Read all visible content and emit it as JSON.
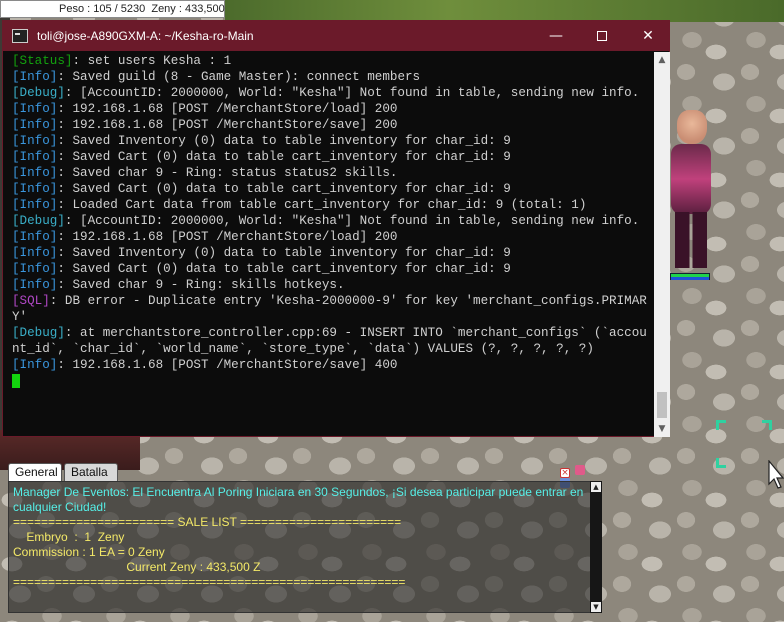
{
  "status_bar": {
    "text": "Peso : 105 / 5230  Zeny : 433,500"
  },
  "terminal": {
    "title": "toli@jose-A890GXM-A: ~/Kesha-ro-Main",
    "controls": {
      "minimize": "—",
      "close": "✕"
    },
    "lines": [
      {
        "tag": "[Status]",
        "tag_type": "status",
        "text": ": set users Kesha : 1"
      },
      {
        "tag": "[Info]",
        "tag_type": "info",
        "text": ": Saved guild (8 - Game Master): connect members"
      },
      {
        "tag": "[Debug]",
        "tag_type": "debug",
        "text": ": [AccountID: 2000000, World: \"Kesha\"] Not found in table, sending new info."
      },
      {
        "tag": "[Info]",
        "tag_type": "info",
        "text": ": 192.168.1.68 [POST /MerchantStore/load] 200"
      },
      {
        "tag": "[Info]",
        "tag_type": "info",
        "text": ": 192.168.1.68 [POST /MerchantStore/save] 200"
      },
      {
        "tag": "[Info]",
        "tag_type": "info",
        "text": ": Saved Inventory (0) data to table inventory for char_id: 9"
      },
      {
        "tag": "[Info]",
        "tag_type": "info",
        "text": ": Saved Cart (0) data to table cart_inventory for char_id: 9"
      },
      {
        "tag": "[Info]",
        "tag_type": "info",
        "text": ": Saved char 9 - Ring: status status2 skills."
      },
      {
        "tag": "[Info]",
        "tag_type": "info",
        "text": ": Saved Cart (0) data to table cart_inventory for char_id: 9"
      },
      {
        "tag": "[Info]",
        "tag_type": "info",
        "text": ": Loaded Cart data from table cart_inventory for char_id: 9 (total: 1)"
      },
      {
        "tag": "[Debug]",
        "tag_type": "debug",
        "text": ": [AccountID: 2000000, World: \"Kesha\"] Not found in table, sending new info."
      },
      {
        "tag": "[Info]",
        "tag_type": "info",
        "text": ": 192.168.1.68 [POST /MerchantStore/load] 200"
      },
      {
        "tag": "[Info]",
        "tag_type": "info",
        "text": ": Saved Inventory (0) data to table inventory for char_id: 9"
      },
      {
        "tag": "[Info]",
        "tag_type": "info",
        "text": ": Saved Cart (0) data to table cart_inventory for char_id: 9"
      },
      {
        "tag": "[Info]",
        "tag_type": "info",
        "text": ": Saved char 9 - Ring: skills hotkeys."
      },
      {
        "tag": "[SQL]",
        "tag_type": "sql",
        "text": ": DB error - Duplicate entry 'Kesha-2000000-9' for key 'merchant_configs.PRIMARY'"
      },
      {
        "tag": "[Debug]",
        "tag_type": "debug",
        "text": ": at merchantstore_controller.cpp:69 - INSERT INTO `merchant_configs` (`account_id`, `char_id`, `world_name`, `store_type`, `data`) VALUES (?, ?, ?, ?, ?)"
      },
      {
        "tag": "[Info]",
        "tag_type": "info",
        "text": ": 192.168.1.68 [POST /MerchantStore/save] 400"
      }
    ]
  },
  "chat": {
    "tabs": [
      "General",
      "Batalla"
    ],
    "lines": [
      {
        "color": "cyan",
        "text": "Manager De Eventos: El Encuentra Al Poring Iniciara en 30 Segundos, ¡Si desea participar puede entrar en cualquier Ciudad!"
      },
      {
        "color": "yellow",
        "text": "======================= SALE LIST ======================="
      },
      {
        "color": "yellow",
        "text": "    Embryo  :  1  Zeny"
      },
      {
        "color": "yellow",
        "text": "Commission : 1 EA = 0 Zeny"
      },
      {
        "color": "yellow",
        "text": "                                  Current Zeny : 433,500 Z"
      },
      {
        "color": "yellow",
        "text": "========================================================"
      }
    ]
  },
  "colors": {
    "title_bar": "#6b1a2a",
    "console_bg": "#0c0c0c",
    "status_tag": "#13a10e",
    "info_tag": "#3a96dd",
    "debug_tag": "#3aafc8",
    "sql_tag": "#b148c6",
    "chat_cyan": "#56f0e8",
    "chat_yellow": "#f4e968"
  }
}
